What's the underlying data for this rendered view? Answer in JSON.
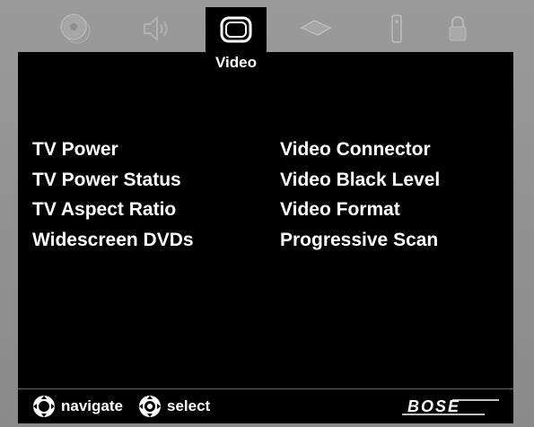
{
  "tabs": [
    {
      "name": "disc-icon",
      "active": false
    },
    {
      "name": "speaker-icon",
      "active": false
    },
    {
      "name": "tv-icon",
      "active": true
    },
    {
      "name": "remote-slab-icon",
      "active": false
    },
    {
      "name": "remote-control-icon",
      "active": false
    },
    {
      "name": "lock-icon",
      "active": false
    }
  ],
  "active_tab_label": "Video",
  "menu": {
    "left": [
      "TV Power",
      "TV Power Status",
      "TV Aspect Ratio",
      "Widescreen DVDs"
    ],
    "right": [
      "Video Connector",
      "Video Black Level",
      "Video Format",
      "Progressive Scan"
    ]
  },
  "footer": {
    "navigate_label": "navigate",
    "select_label": "select",
    "brand": "BOSE"
  },
  "colors": {
    "screen": "#000000",
    "frame": "#8e8e8e",
    "inactive_icon": "#a8a8a8",
    "text": "#ffffff"
  }
}
